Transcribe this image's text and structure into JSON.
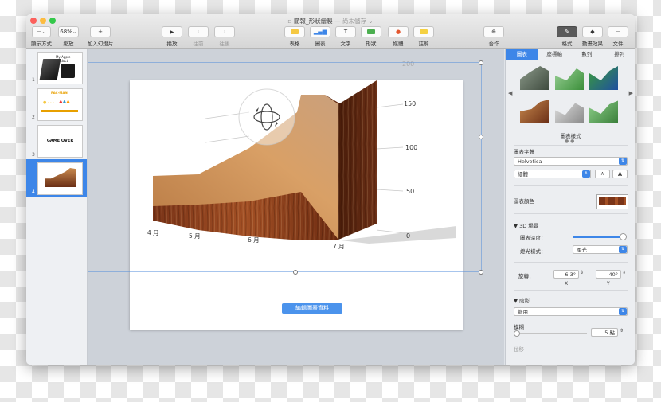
{
  "window": {
    "title": "簡報_形狀繪製",
    "title_sep": " — ",
    "title_status": "尚未儲存"
  },
  "toolbar": {
    "view_label": "顯示方式",
    "zoom_value": "68%",
    "zoom_label": "縮放",
    "add_slide_label": "加入幻燈片",
    "play_label": "播放",
    "back_label": "往前",
    "forward_label": "往後",
    "table_label": "表格",
    "chart_label": "圖表",
    "text_label": "文字",
    "shape_label": "形狀",
    "media_label": "媒體",
    "comment_label": "註解",
    "collab_label": "合作",
    "format_label": "格式",
    "animate_label": "動畫效果",
    "document_label": "文件"
  },
  "slides": [
    {
      "num": "1",
      "title": "My Apple Product"
    },
    {
      "num": "2",
      "title": "PAC-MAN"
    },
    {
      "num": "3",
      "title": "GAME OVER"
    },
    {
      "num": "4",
      "title": ""
    }
  ],
  "canvas": {
    "edit_chart_button": "編輯圖表資料"
  },
  "chart_data": {
    "type": "area",
    "style": "3D wood",
    "categories": [
      "4 月",
      "5 月",
      "6 月",
      "7 月"
    ],
    "values": [
      60,
      60,
      110,
      200
    ],
    "yticks": [
      "0",
      "50",
      "100",
      "150",
      "200"
    ],
    "ylim": [
      0,
      200
    ]
  },
  "inspector": {
    "tabs": [
      "圖表",
      "座標軸",
      "數列",
      "排列"
    ],
    "styles_label": "圖表樣式",
    "font_section": "圖表字體",
    "font_name": "Helvetica",
    "font_weight": "細體",
    "font_smaller": "A",
    "font_larger": "A",
    "color_section": "圖表顏色",
    "scene_section": "3D 場景",
    "depth_label": "圖表深度：",
    "lighting_label": "燈光樣式：",
    "lighting_value": "柔光",
    "rotate_label": "旋轉：",
    "rotate_x_value": "-6.3°",
    "rotate_y_value": "-40°",
    "rotate_x_label": "X",
    "rotate_y_label": "Y",
    "shadow_section": "陰影",
    "shadow_value": "斷用",
    "blur_label": "模糊",
    "blur_value": "5 點",
    "next_label": "位移",
    "colors": {
      "accent": "#3d86e8",
      "wood_dark": "#6b2f16",
      "wood_light": "#c98a4e"
    }
  }
}
